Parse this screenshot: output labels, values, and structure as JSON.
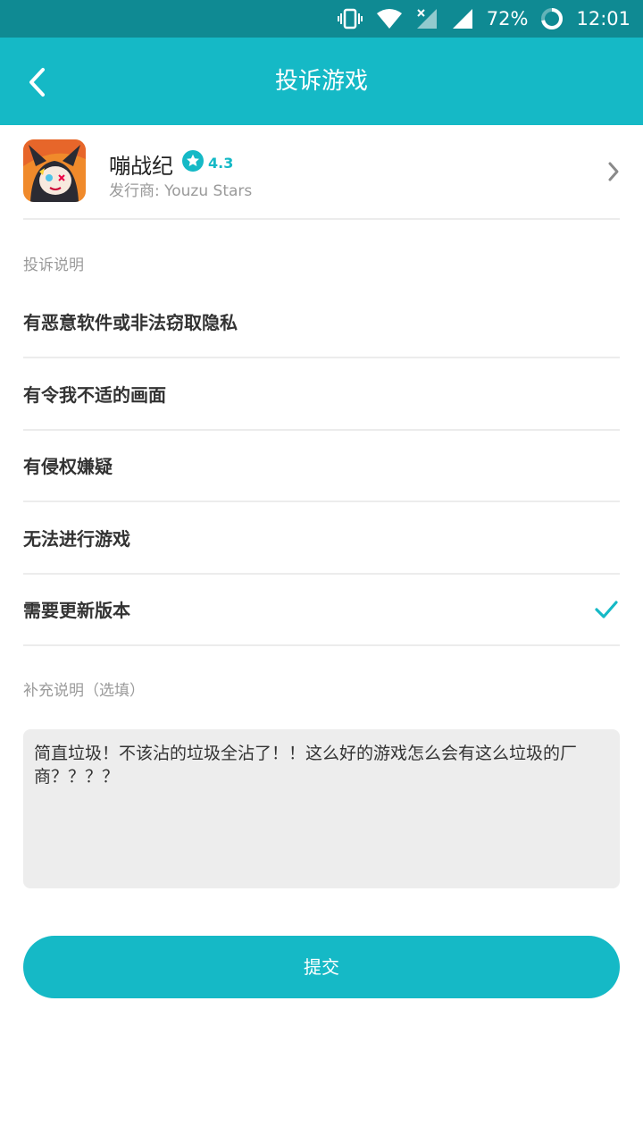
{
  "status_bar": {
    "battery": "72%",
    "time": "12:01",
    "icons": [
      "vibrate-icon",
      "wifi-icon",
      "no-signal-icon",
      "signal-icon",
      "battery-icon"
    ]
  },
  "header": {
    "title": "投诉游戏",
    "back_icon": "back-arrow-icon"
  },
  "game": {
    "name": "嘣战纪",
    "rating": "4.3",
    "publisher": "发行商:  Youzu Stars",
    "icon": "game-avatar-icon"
  },
  "complaint": {
    "section_label": "投诉说明",
    "options": [
      {
        "label": "有恶意软件或非法窃取隐私",
        "selected": false
      },
      {
        "label": "有令我不适的画面",
        "selected": false
      },
      {
        "label": "有侵权嫌疑",
        "selected": false
      },
      {
        "label": "无法进行游戏",
        "selected": false
      },
      {
        "label": "需要更新版本",
        "selected": true
      }
    ]
  },
  "supplement": {
    "section_label": "补充说明（选填）",
    "text": "简直垃圾！不该沾的垃圾全沾了！！这么好的游戏怎么会有这么垃圾的厂商？？？？"
  },
  "submit": {
    "label": "提交"
  },
  "colors": {
    "accent": "#15b9c6",
    "status_bar": "#0f8a93",
    "input_bg": "#ededed"
  }
}
